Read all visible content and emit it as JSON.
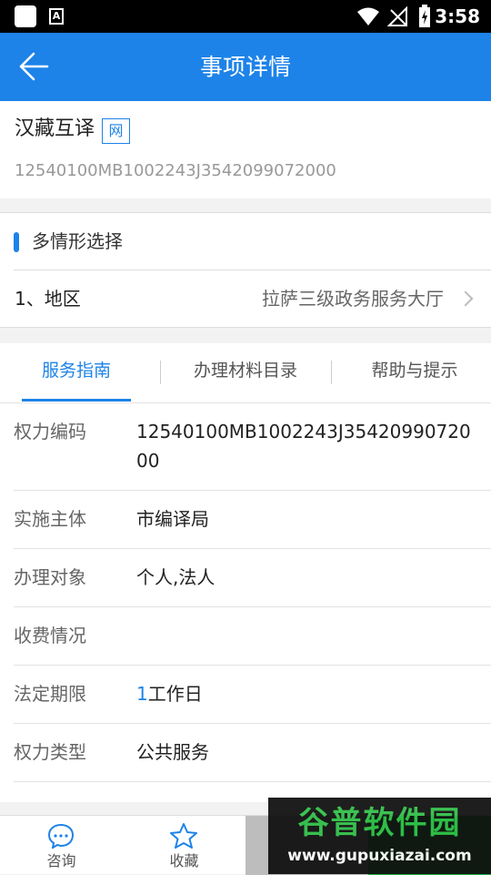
{
  "status_bar": {
    "time": "3:58",
    "a_icon_label": "A"
  },
  "header": {
    "title": "事项详情"
  },
  "item": {
    "name": "汉藏互译",
    "tag": "网",
    "code": "12540100MB1002243J3542099072000"
  },
  "situation": {
    "section_title": "多情形选择",
    "region_label": "1、地区",
    "region_value": "拉萨三级政务服务大厅"
  },
  "tabs": [
    {
      "label": "服务指南",
      "active": true
    },
    {
      "label": "办理材料目录",
      "active": false
    },
    {
      "label": "帮助与提示",
      "active": false
    }
  ],
  "details": {
    "power_code": {
      "label": "权力编码",
      "value": "12540100MB1002243J3542099072000"
    },
    "subject": {
      "label": "实施主体",
      "value": "市编译局"
    },
    "target": {
      "label": "办理对象",
      "value": "个人,法人"
    },
    "fee": {
      "label": "收费情况",
      "value": ""
    },
    "deadline": {
      "label": "法定期限",
      "number": "1",
      "unit": "工作日"
    },
    "power_type": {
      "label": "权力类型",
      "value": "公共服务"
    }
  },
  "bottom_nav": {
    "consult": "咨询",
    "favorite": "收藏"
  },
  "watermark": {
    "title": "谷普软件园",
    "url": "www.gupuxiazai.com"
  },
  "colors": {
    "primary": "#1d83e8",
    "green": "#21b04b"
  }
}
